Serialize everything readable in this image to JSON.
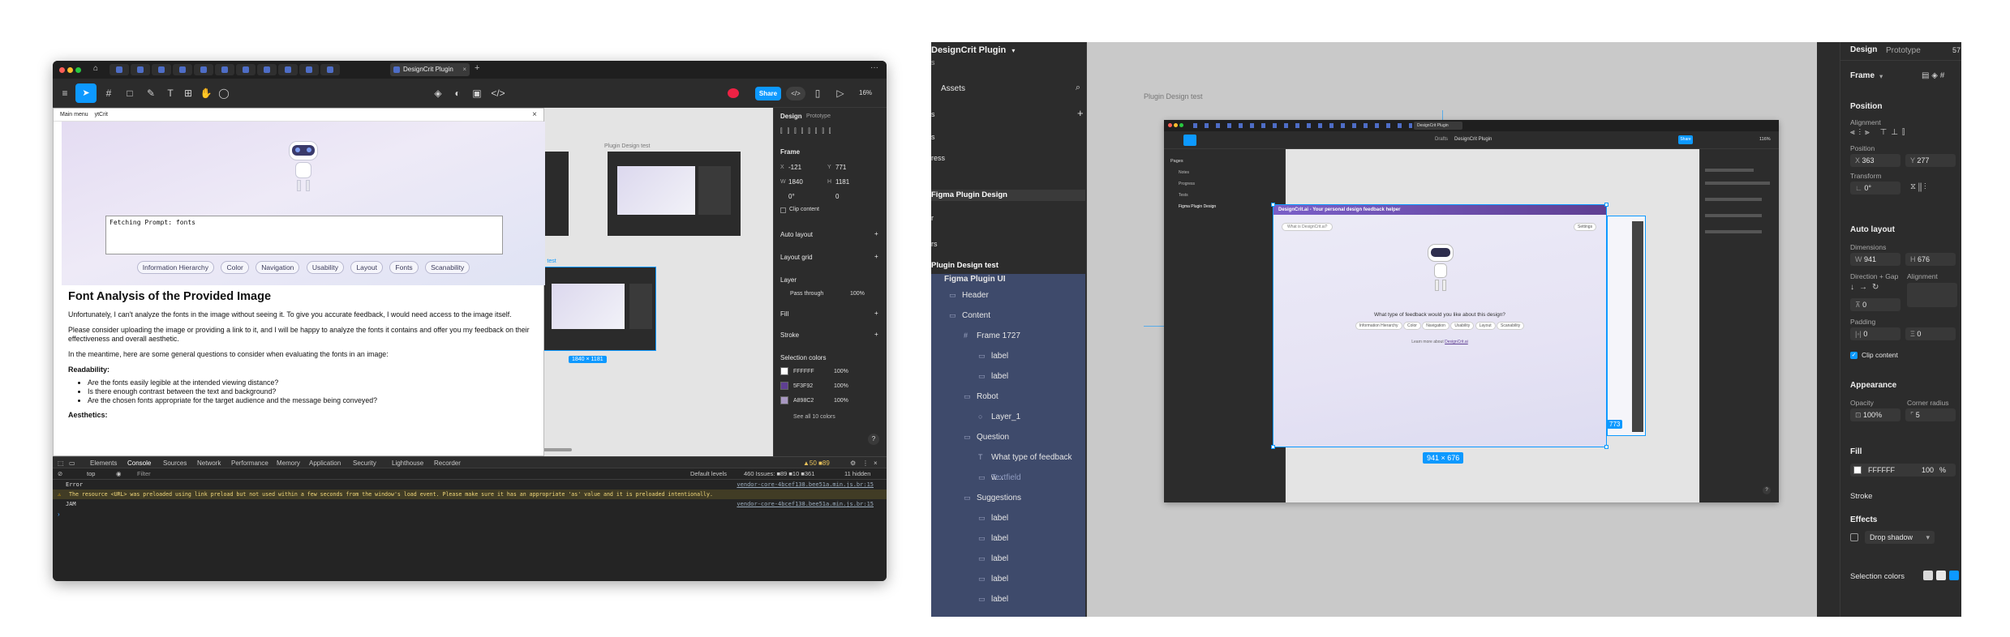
{
  "left_window": {
    "browser_tab": "DesignCrit Plugin",
    "zoom": "16%",
    "share_label": "Share",
    "breadcrumb_main": "Main menu",
    "breadcrumb_sub": "ytCrit",
    "plugin": {
      "prompt_text": "Fetching Prompt: fonts",
      "chips": [
        "Information Hierarchy",
        "Color",
        "Navigation",
        "Usability",
        "Layout",
        "Fonts",
        "Scanability"
      ],
      "heading": "Font Analysis of the Provided Image",
      "para1": "Unfortunately, I can't analyze the fonts in the image without seeing it. To give you accurate feedback, I would need access to the image itself.",
      "para2": "Please consider uploading the image or providing a link to it, and I will be happy to analyze the fonts it contains and offer you my feedback on their effectiveness and overall aesthetic.",
      "para3": "In the meantime, here are some general questions to consider when evaluating the fonts in an image:",
      "sub1": "Readability:",
      "bullets": [
        "Are the fonts easily legible at the intended viewing distance?",
        "Is there enough contrast between the text and background?",
        "Are the chosen fonts appropriate for the target audience and the message being conveyed?"
      ],
      "sub2": "Aesthetics:"
    },
    "canvas": {
      "frame_label": "Plugin Design test",
      "frame_label_small": "le test",
      "size_badge": "1840 × 1181"
    },
    "design_panel": {
      "tab_design": "Design",
      "tab_prototype": "Prototype",
      "frame_label": "Frame",
      "x": "-121",
      "y": "771",
      "w": "1840",
      "h": "1181",
      "rot": "0°",
      "radius": "0",
      "clip": "Clip content",
      "auto_layout": "Auto layout",
      "layout_grid": "Layout grid",
      "layer": "Layer",
      "pass_through": "Pass through",
      "layer_opacity": "100%",
      "fill": "Fill",
      "stroke": "Stroke",
      "selection_colors": "Selection colors",
      "colors": [
        {
          "hex": "FFFFFF",
          "pct": "100%",
          "swatch": "#FFFFFF"
        },
        {
          "hex": "5F3F92",
          "pct": "100%",
          "swatch": "#5F3F92"
        },
        {
          "hex": "A898C2",
          "pct": "100%",
          "swatch": "#A898C2"
        }
      ],
      "see_all": "See all 10 colors"
    },
    "devtools": {
      "tabs": [
        "Elements",
        "Console",
        "Sources",
        "Network",
        "Performance",
        "Memory",
        "Application",
        "Security",
        "Lighthouse",
        "Recorder"
      ],
      "active_tab": "Console",
      "counts": "▲50  ■89",
      "context": "top",
      "filter": "Filter",
      "levels": "Default levels",
      "issues": "460 Issues: ■89 ■10 ■361",
      "hidden": "11 hidden",
      "line1": "Error",
      "line2": "The resource <URL> was preloaded using link preload but not used within a few seconds from the window's load event. Please make sure it has an appropriate 'as' value and it is preloaded intentionally.",
      "line3": "JAM",
      "link1": "vendor-core-4bcef138.bee51a.min.js.br:15",
      "link2": "vendor-core-4bcef138.bee51a.min.js.br:15"
    }
  },
  "right_window": {
    "app_title": "DesignCrit Plugin",
    "assets": "Assets",
    "layers": [
      {
        "label": "Figma Plugin Design",
        "indent": 0,
        "glyph": ""
      },
      {
        "label": "Plugin Design test",
        "indent": 0,
        "glyph": ""
      },
      {
        "label": "Figma Plugin UI",
        "indent": 0,
        "glyph": ""
      },
      {
        "label": "Header",
        "indent": 1,
        "glyph": "▭"
      },
      {
        "label": "Content",
        "indent": 1,
        "glyph": "▭"
      },
      {
        "label": "Frame 1727",
        "indent": 2,
        "glyph": "#"
      },
      {
        "label": "label",
        "indent": 3,
        "glyph": "▭"
      },
      {
        "label": "label",
        "indent": 3,
        "glyph": "▭"
      },
      {
        "label": "Robot",
        "indent": 2,
        "glyph": "▭"
      },
      {
        "label": "Layer_1",
        "indent": 3,
        "glyph": "○"
      },
      {
        "label": "Question",
        "indent": 2,
        "glyph": "▭"
      },
      {
        "label": "What type of feedback w...",
        "indent": 3,
        "glyph": "T"
      },
      {
        "label": "Textfield",
        "indent": 3,
        "glyph": "▭"
      },
      {
        "label": "Suggestions",
        "indent": 2,
        "glyph": "▭"
      },
      {
        "label": "label",
        "indent": 3,
        "glyph": "▭"
      },
      {
        "label": "label",
        "indent": 3,
        "glyph": "▭"
      },
      {
        "label": "label",
        "indent": 3,
        "glyph": "▭"
      },
      {
        "label": "label",
        "indent": 3,
        "glyph": "▭"
      },
      {
        "label": "label",
        "indent": 3,
        "glyph": "▭"
      }
    ],
    "left_stubs": [
      "s",
      "s",
      "ress",
      "r",
      "rs"
    ],
    "canvas": {
      "frame_label": "Plugin Design test",
      "size_badge": "941 × 676",
      "side_badge": "773",
      "inner": {
        "plugin_bar": "DesignCrit.ai - Your personal design feedback helper",
        "input_ph": "What is DesignCrit.ai?",
        "settings": "Settings",
        "question": "What type of feedback would you like about this design?",
        "chips": [
          "Information Hierarchy",
          "Color",
          "Navigation",
          "Usability",
          "Layout",
          "Scanability"
        ],
        "learn_prefix": "Learn more about",
        "learn_link": "DesignCrit.ai",
        "pages_heading": "Pages",
        "pages": [
          "Notes",
          "Progress",
          "Tests",
          "Figma Plugin Design"
        ],
        "breadcrumb_left": "Drafts",
        "breadcrumb_right": "DesignCrit Plugin",
        "share": "Share",
        "zoom": "116%"
      }
    },
    "design_panel": {
      "tab_design": "Design",
      "tab_prototype": "Prototype",
      "zoom_stub": "57",
      "frame": "Frame",
      "position": "Position",
      "alignment": "Alignment",
      "position_sub": "Position",
      "x": "363",
      "y": "277",
      "transform": "Transform",
      "rot": "0°",
      "auto_layout": "Auto layout",
      "dimensions": "Dimensions",
      "w": "941",
      "h": "676",
      "direction_gap": "Direction + Gap",
      "alignment2": "Alignment",
      "gap": "0",
      "padding": "Padding",
      "pad_h": "0",
      "pad_v": "0",
      "clip": "Clip content",
      "appearance": "Appearance",
      "opacity_label": "Opacity",
      "radius_label": "Corner radius",
      "opacity": "100%",
      "radius": "5",
      "fill": "Fill",
      "fill_hex": "FFFFFF",
      "fill_pct": "100",
      "fill_unit": "%",
      "stroke": "Stroke",
      "effects": "Effects",
      "drop_shadow": "Drop shadow",
      "selection_colors": "Selection colors"
    }
  },
  "colors": {
    "accent": "#0d99ff",
    "panel": "#2c2c2c",
    "selection": "#3e4a6b",
    "plugin_purple": "#5F3F92"
  }
}
